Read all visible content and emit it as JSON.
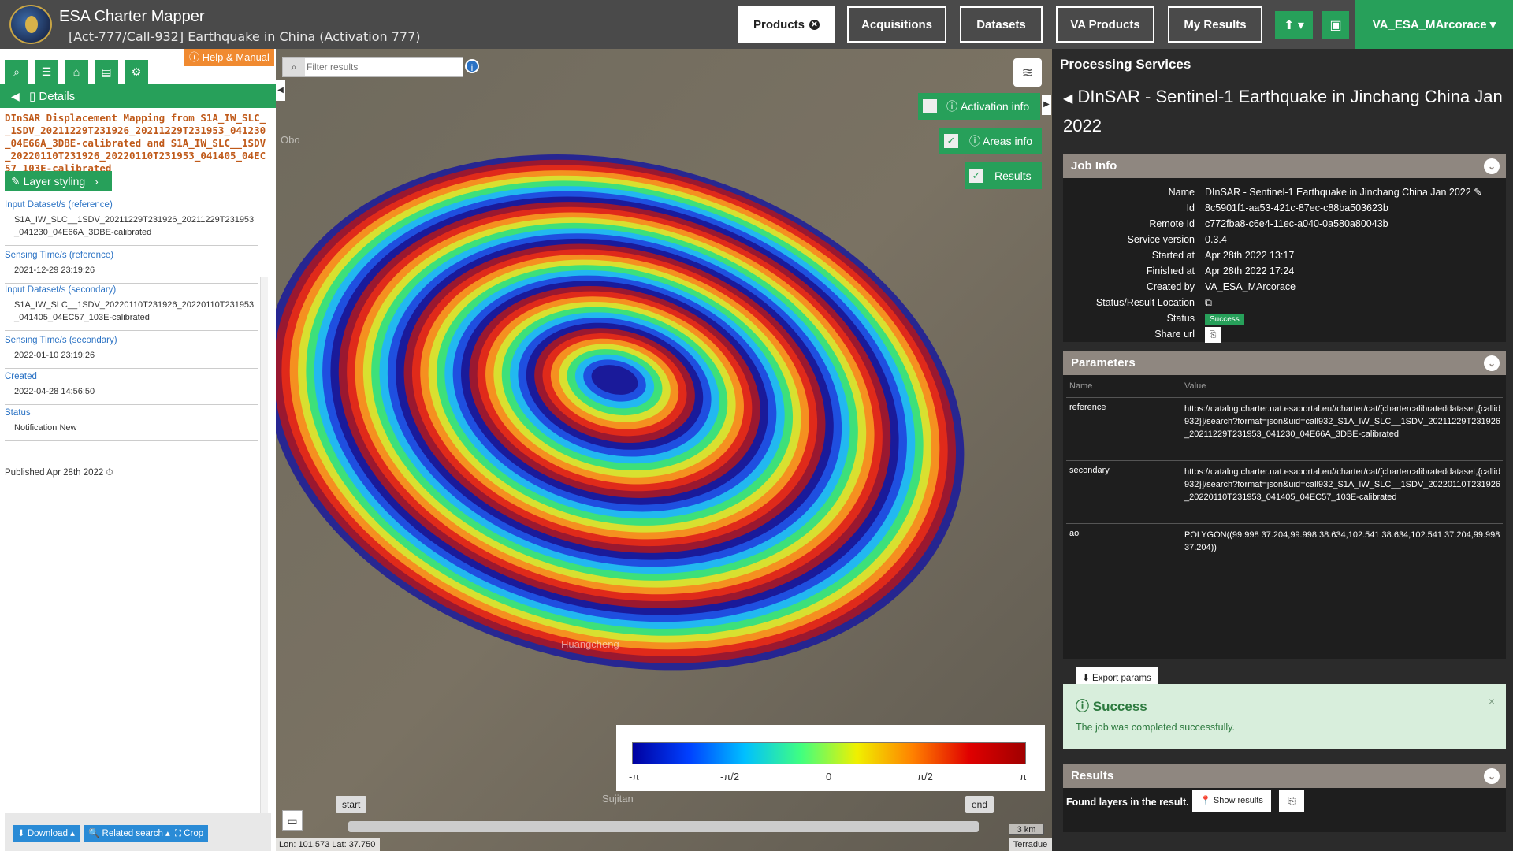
{
  "header": {
    "app_title": "ESA Charter Mapper",
    "subtitle": "[Act-777/Call-932] Earthquake in China (Activation 777)",
    "nav": {
      "products": "Products",
      "acquisitions": "Acquisitions",
      "datasets": "Datasets",
      "va_products": "VA Products",
      "my_results": "My Results"
    },
    "user": "VA_ESA_MArcorace ▾",
    "upload_icon": "upload-icon",
    "briefcase_icon": "briefcase-icon"
  },
  "left": {
    "help": "ⓘ Help & Manual",
    "details": "Details",
    "product_title": "DInSAR Displacement Mapping from S1A_IW_SLC__1SDV_20211229T231926_20211229T231953_041230_04E66A_3DBE-calibrated and S1A_IW_SLC__1SDV_20220110T231926_20220110T231953_041405_04EC57_103E-calibrated",
    "layer_styling": "Layer styling",
    "meta": [
      {
        "label": "Input Dataset/s (reference)",
        "value": "S1A_IW_SLC__1SDV_20211229T231926_20211229T231953_041230_04E66A_3DBE-calibrated"
      },
      {
        "label": "Sensing Time/s (reference)",
        "value": "2021-12-29 23:19:26"
      },
      {
        "label": "Input Dataset/s (secondary)",
        "value": "S1A_IW_SLC__1SDV_20220110T231926_20220110T231953_041405_04EC57_103E-calibrated"
      },
      {
        "label": "Sensing Time/s (secondary)",
        "value": "2022-01-10 23:19:26"
      },
      {
        "label": "Created",
        "value": "2022-04-28 14:56:50"
      },
      {
        "label": "Status",
        "value": "Notification New"
      }
    ],
    "published": "Published Apr 28th 2022 ⏱",
    "footer": {
      "download": "⬇ Download ▴",
      "related": "🔍 Related search ▴",
      "crop": "⛶ Crop"
    }
  },
  "map": {
    "filter_placeholder": "Filter results",
    "toggles": {
      "activation": "Activation info",
      "areas": "Areas info",
      "results": "Results"
    },
    "towns": {
      "obo": "Obo",
      "huangcheng": "Huangcheng",
      "sujitan": "Sujitan"
    },
    "legend": [
      "-π",
      "-π/2",
      "0",
      "π/2",
      "π"
    ],
    "time": {
      "start": "start",
      "end": "end"
    },
    "scale": "3 km",
    "coords": "Lon: 101.573 Lat: 37.750",
    "attribution": "Terradue"
  },
  "right": {
    "section_title": "Processing Services",
    "job_title": "DInSAR - Sentinel-1 Earthquake in Jinchang China Jan 2022",
    "job_info": {
      "heading": "Job Info",
      "rows": [
        {
          "key": "Name",
          "value": "DInSAR - Sentinel-1 Earthquake in Jinchang China Jan 2022 ✎"
        },
        {
          "key": "Id",
          "value": "8c5901f1-aa53-421c-87ec-c88ba503623b"
        },
        {
          "key": "Remote Id",
          "value": "c772fba8-c6e4-11ec-a040-0a580a80043b"
        },
        {
          "key": "Service version",
          "value": "0.3.4"
        },
        {
          "key": "Started at",
          "value": "Apr 28th 2022 13:17"
        },
        {
          "key": "Finished at",
          "value": "Apr 28th 2022 17:24"
        },
        {
          "key": "Created by",
          "value": "VA_ESA_MArcorace"
        },
        {
          "key": "Status/Result Location",
          "value": "⧉"
        },
        {
          "key": "Status",
          "value": "Success"
        },
        {
          "key": "Share url",
          "value": "⎘"
        }
      ]
    },
    "parameters": {
      "heading": "Parameters",
      "col_name": "Name",
      "col_value": "Value",
      "rows": [
        {
          "name": "reference",
          "value": "https://catalog.charter.uat.esaportal.eu//charter/cat/[chartercalibrateddataset,{callid932}]/search?format=json&uid=call932_S1A_IW_SLC__1SDV_20211229T231926_20211229T231953_041230_04E66A_3DBE-calibrated"
        },
        {
          "name": "secondary",
          "value": "https://catalog.charter.uat.esaportal.eu//charter/cat/[chartercalibrateddataset,{callid932}]/search?format=json&uid=call932_S1A_IW_SLC__1SDV_20220110T231926_20220110T231953_041405_04EC57_103E-calibrated"
        },
        {
          "name": "aoi",
          "value": "POLYGON((99.998 37.204,99.998 38.634,102.541 38.634,102.541 37.204,99.998 37.204))"
        }
      ],
      "export": "⬇ Export params"
    },
    "success": {
      "title": "Success",
      "message": "The job was completed successfully.",
      "close": "×"
    },
    "results": {
      "heading": "Results",
      "found": "Found layers in the result.",
      "show": "📍 Show results",
      "copy": "⎘"
    }
  }
}
